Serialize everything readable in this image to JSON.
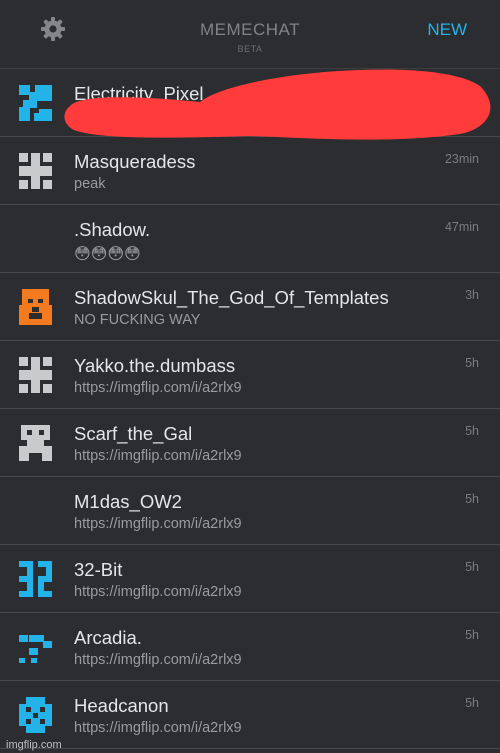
{
  "header": {
    "title": "MEMECHAT",
    "subtitle": "BETA",
    "new_label": "NEW",
    "settings_icon": "gear-icon"
  },
  "colors": {
    "background": "#2c2d30",
    "accent": "#23b3e8",
    "orange": "#f47a1f",
    "grey_avatar": "#c9cacc",
    "redaction": "#ff3b3b"
  },
  "chats": [
    {
      "name": "Electricity_Pixel",
      "message": "",
      "time": "",
      "avatar": "blue-pixel-avatar"
    },
    {
      "name": "Masqueradess",
      "message": "peak",
      "time": "23min",
      "avatar": "grey-hash-avatar"
    },
    {
      "name": ".Shadow.",
      "message": "😳😳😳😳",
      "time": "47min",
      "avatar": "none"
    },
    {
      "name": "ShadowSkul_The_God_Of_Templates",
      "message": "NO FUCKING WAY",
      "time": "3h",
      "avatar": "orange-skull-avatar"
    },
    {
      "name": "Yakko.the.dumbass",
      "message": "https://imgflip.com/i/a2rlx9",
      "time": "5h",
      "avatar": "grey-hash-avatar"
    },
    {
      "name": "Scarf_the_Gal",
      "message": "https://imgflip.com/i/a2rlx9",
      "time": "5h",
      "avatar": "grey-face-avatar"
    },
    {
      "name": "M1das_OW2",
      "message": "https://imgflip.com/i/a2rlx9",
      "time": "5h",
      "avatar": "none"
    },
    {
      "name": "32-Bit",
      "message": "https://imgflip.com/i/a2rlx9",
      "time": "5h",
      "avatar": "blue-32-avatar"
    },
    {
      "name": "Arcadia.",
      "message": "https://imgflip.com/i/a2rlx9",
      "time": "5h",
      "avatar": "blue-dots-avatar"
    },
    {
      "name": "Headcanon",
      "message": "https://imgflip.com/i/a2rlx9",
      "time": "5h",
      "avatar": "blue-checker-avatar"
    }
  ],
  "watermark": "imgflip.com"
}
